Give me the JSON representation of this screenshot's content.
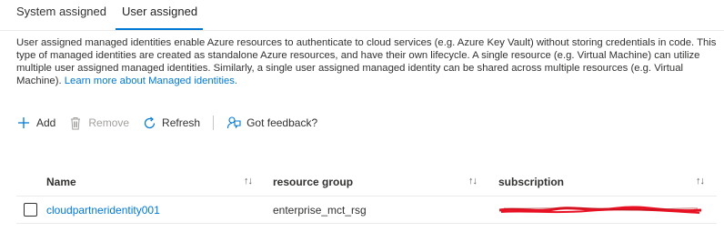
{
  "tabs": [
    {
      "label": "System assigned",
      "active": false
    },
    {
      "label": "User assigned",
      "active": true
    }
  ],
  "description": {
    "text": "User assigned managed identities enable Azure resources to authenticate to cloud services (e.g. Azure Key Vault) without storing credentials in code. This type of managed identities are created as standalone Azure resources, and have their own lifecycle. A single resource (e.g. Virtual Machine) can utilize multiple user assigned managed identities. Similarly, a single user assigned managed identity can be shared across multiple resources (e.g. Virtual Machine).",
    "link_label": "Learn more about Managed identities."
  },
  "toolbar": {
    "add_label": "Add",
    "remove_label": "Remove",
    "refresh_label": "Refresh",
    "feedback_label": "Got feedback?"
  },
  "table": {
    "columns": [
      "Name",
      "resource group",
      "subscription"
    ],
    "rows": [
      {
        "name": "cloudpartneridentity001",
        "resource_group": "enterprise_mct_rsg",
        "subscription": ""
      }
    ]
  },
  "colors": {
    "accent": "#0078d4",
    "text": "#323130",
    "redaction": "#e81123"
  },
  "icons": [
    "add-icon",
    "trash-icon",
    "refresh-icon",
    "feedback-icon",
    "sort-icon",
    "checkbox-icon"
  ]
}
